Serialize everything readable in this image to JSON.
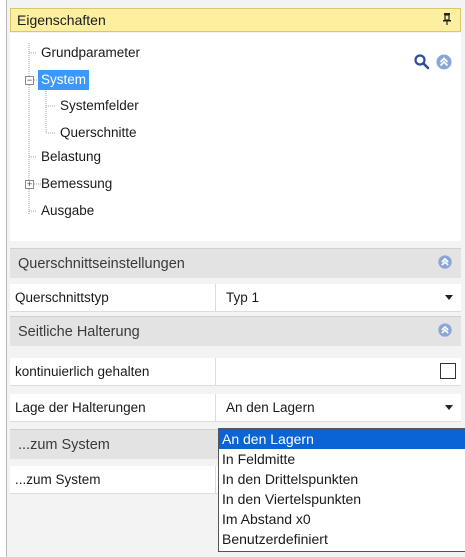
{
  "panel": {
    "title": "Eigenschaften",
    "pin_icon": "pin-icon"
  },
  "tree": {
    "items": [
      {
        "label": "Grundparameter"
      },
      {
        "label": "System",
        "expanded": true
      },
      {
        "label": "Systemfelder"
      },
      {
        "label": "Querschnitte"
      },
      {
        "label": "Belastung"
      },
      {
        "label": "Bemessung",
        "expanded": false
      },
      {
        "label": "Ausgabe"
      }
    ],
    "selected": "System",
    "search_icon": "magnifier-icon",
    "collapse_icon": "double-chevron-up-icon"
  },
  "sections": {
    "querschnitt": {
      "title": "Querschnittseinstellungen",
      "rows": [
        {
          "label": "Querschnittstyp",
          "value": "Typ 1"
        }
      ]
    },
    "halterung": {
      "title": "Seitliche Halterung",
      "rows": [
        {
          "label": "kontinuierlich gehalten",
          "checked": false
        },
        {
          "label": "Lage der Halterungen",
          "value": "An den Lagern"
        }
      ]
    },
    "system": {
      "title": "...zum System",
      "rows": [
        {
          "label": "...zum System"
        }
      ]
    }
  },
  "dropdown": {
    "options": [
      "An den Lagern",
      "In Feldmitte",
      "In den Drittelspunkten",
      "In den Viertelspunkten",
      "Im Abstand x0",
      "Benutzerdefiniert"
    ],
    "selected": "An den Lagern"
  },
  "colors": {
    "title_bg": "#fcf0a0",
    "tree_selected": "#3b99fc",
    "dropdown_selected": "#0a64d6",
    "section_bg": "#e3e3e3",
    "collapse_icon": "#8aa6d8"
  }
}
